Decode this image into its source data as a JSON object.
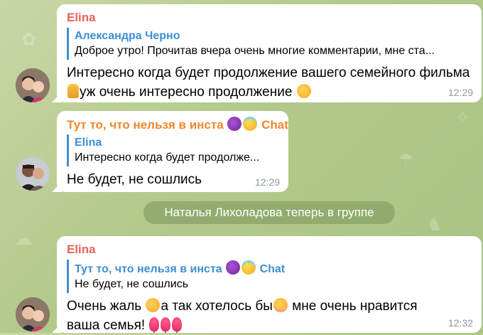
{
  "colors": {
    "sender_elina": "#e8625a",
    "sender_chat": "#f0872c",
    "quote_accent": "#3d8fd1",
    "time": "#8a9aa6"
  },
  "messages": [
    {
      "sender": "Elina",
      "quote_author": "Александра Черно",
      "quote_text": "Доброе утро! Прочитав вчера очень многие комментарии, мне ста...",
      "text_part1": "Интересно когда будет продолжение вашего семейного фильма",
      "text_part2": "уж очень интересно продолжение",
      "time": "12:29"
    },
    {
      "sender": "Тут то, что нельзя в инста",
      "sender_suffix": "Chat",
      "quote_author": "Elina",
      "quote_text": "Интересно когда будет продолже...",
      "text": "Не будет, не сошлись",
      "time": "12:29"
    },
    {
      "sender": "Elina",
      "quote_author": "Тут то, что нельзя в инста",
      "quote_author_suffix": "Chat",
      "quote_text": "Не будет, не сошлись",
      "text_part1": "Очень жаль",
      "text_part2": "а так хотелось бы",
      "text_part3": "мне очень нравится ваша семья!",
      "time": "12:32"
    }
  ],
  "service_message": "Наталья Лихоладова теперь в группе",
  "icons": [
    "devil-emoji",
    "halo-emoji",
    "pray-emoji",
    "love-emoji",
    "pensive-emoji",
    "blush-emoji",
    "tulip-emoji"
  ]
}
